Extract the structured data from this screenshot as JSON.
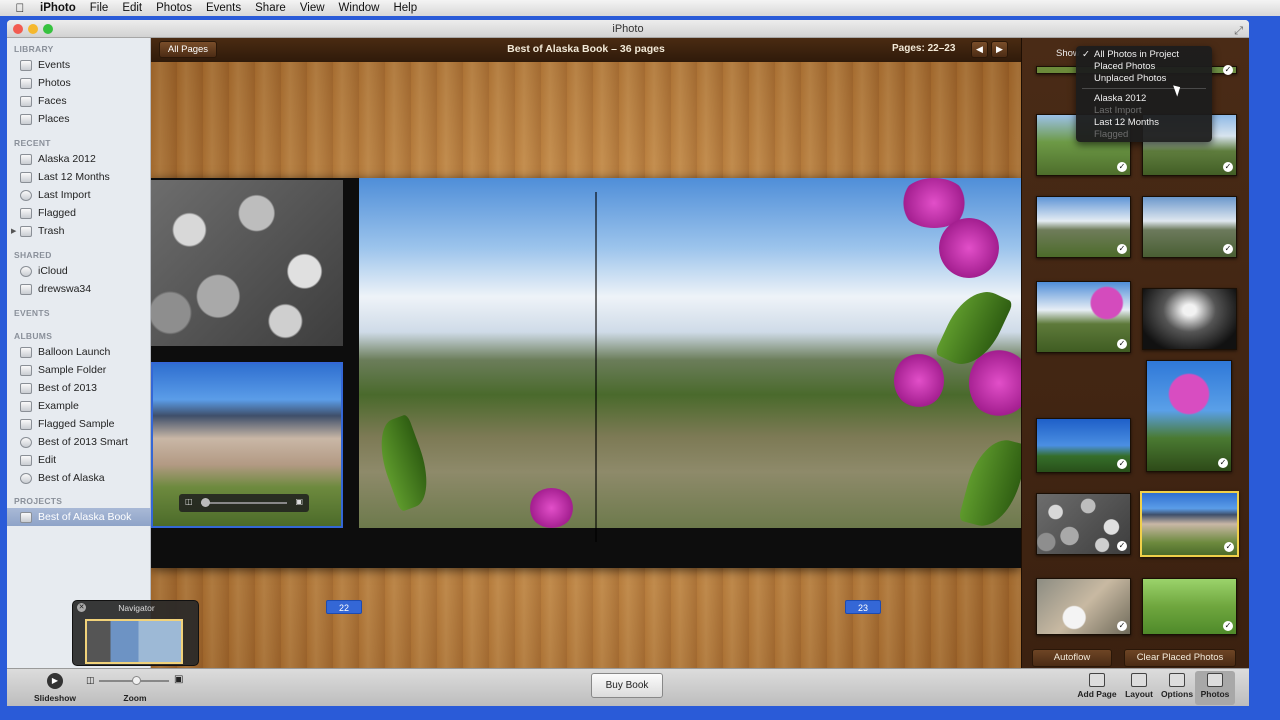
{
  "menubar": {
    "apple": "",
    "app": "iPhoto",
    "items": [
      "File",
      "Edit",
      "Photos",
      "Events",
      "Share",
      "View",
      "Window",
      "Help"
    ]
  },
  "window": {
    "title": "iPhoto"
  },
  "sidebar": {
    "sections": [
      {
        "title": "LIBRARY",
        "items": [
          "Events",
          "Photos",
          "Faces",
          "Places"
        ]
      },
      {
        "title": "RECENT",
        "items": [
          "Alaska 2012",
          "Last 12 Months",
          "Last Import",
          "Flagged",
          "Trash"
        ]
      },
      {
        "title": "SHARED",
        "items": [
          "iCloud",
          "drewswa34"
        ]
      },
      {
        "title": "EVENTS",
        "items": []
      },
      {
        "title": "ALBUMS",
        "items": [
          "Balloon Launch",
          "Sample Folder",
          "Best of 2013",
          "Example",
          "Flagged Sample",
          "Best of 2013 Smart",
          "Edit",
          "Best of Alaska"
        ]
      },
      {
        "title": "PROJECTS",
        "items": [
          "Best of Alaska Book"
        ]
      }
    ],
    "selected": "Best of Alaska Book"
  },
  "book": {
    "all_pages": "All Pages",
    "title": "Best of Alaska Book – 36 pages",
    "pages_info": "Pages: 22–23",
    "prev": "◀",
    "next": "▶",
    "page_left": "22",
    "page_right": "23"
  },
  "navigator": {
    "title": "Navigator"
  },
  "bottombar": {
    "slideshow": "Slideshow",
    "zoom": "Zoom",
    "buy_book": "Buy Book",
    "tools": [
      "Add Page",
      "Layout",
      "Options",
      "Photos"
    ],
    "selected_tool": "Photos"
  },
  "rpanel": {
    "show_label": "Show",
    "autoflow": "Autoflow",
    "clear_placed": "Clear Placed Photos",
    "dropdown": [
      {
        "label": "All Photos in Project",
        "checked": true,
        "enabled": true
      },
      {
        "label": "Placed Photos",
        "checked": false,
        "enabled": true
      },
      {
        "label": "Unplaced Photos",
        "checked": false,
        "enabled": true
      },
      {
        "label": "Alaska 2012",
        "checked": false,
        "enabled": true
      },
      {
        "label": "Last Import",
        "checked": false,
        "enabled": false
      },
      {
        "label": "Last 12 Months",
        "checked": false,
        "enabled": true
      },
      {
        "label": "Flagged",
        "checked": false,
        "enabled": false
      }
    ]
  }
}
